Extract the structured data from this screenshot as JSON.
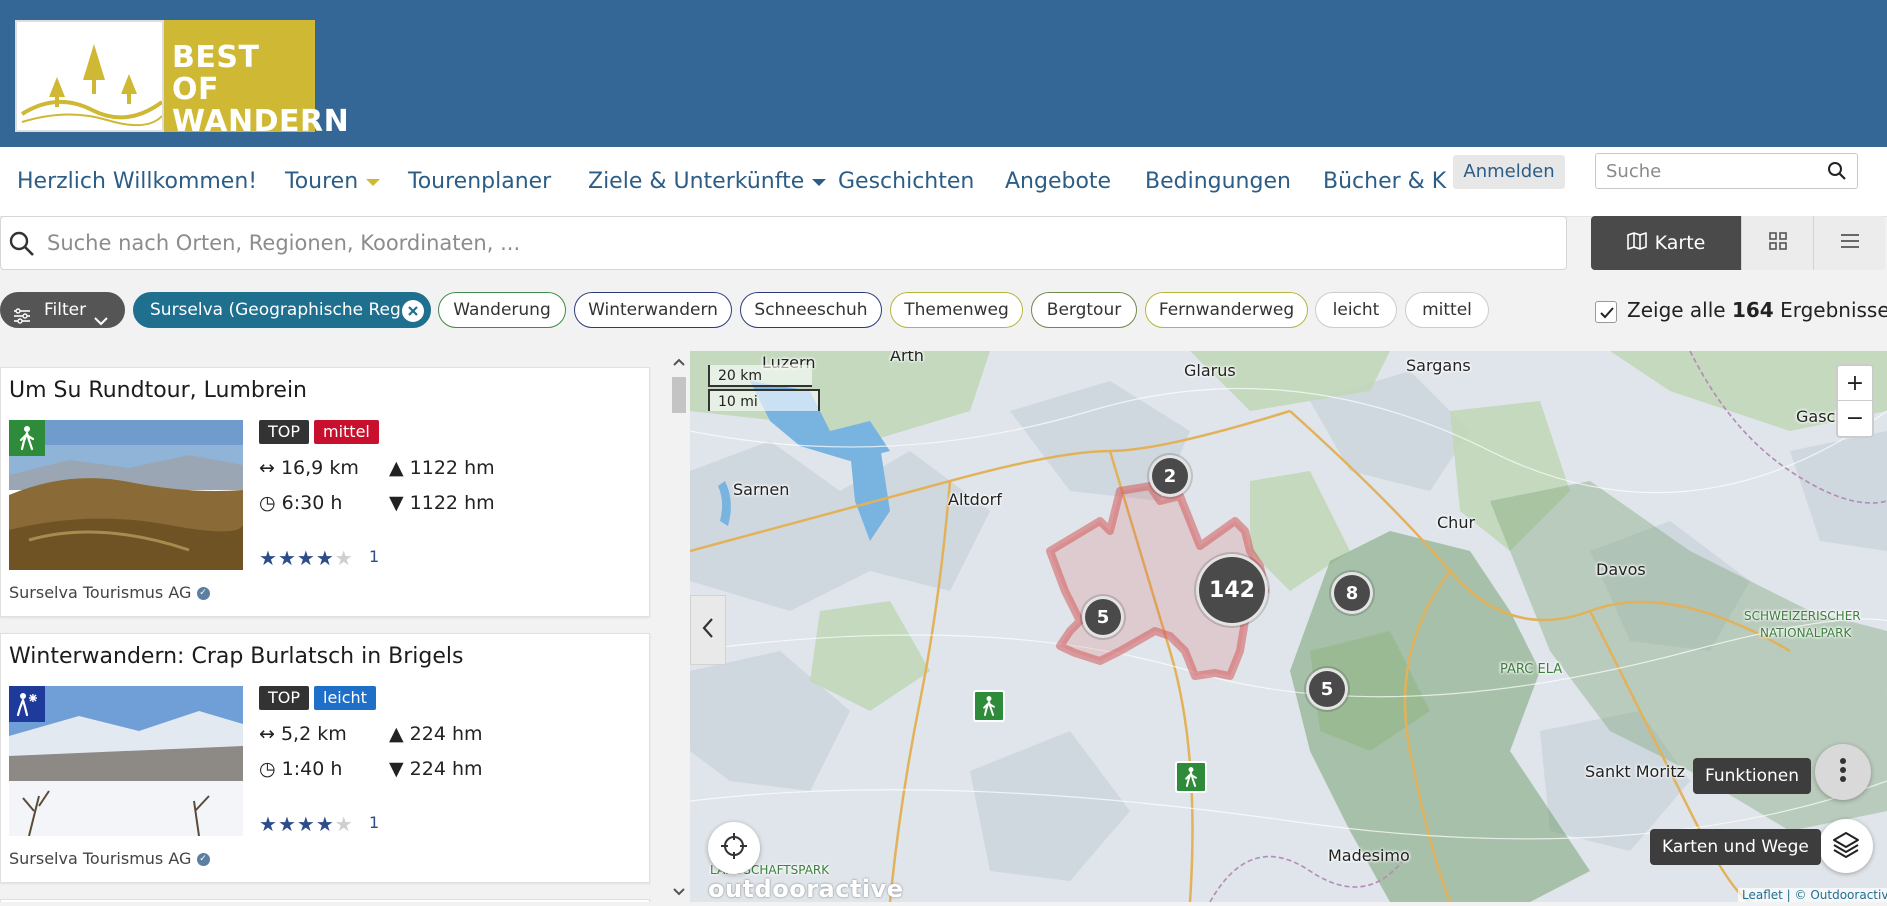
{
  "logo": {
    "line1": "BEST OF",
    "line2": "WANDERN"
  },
  "nav": {
    "items": [
      "Herzlich Willkommen!",
      "Touren",
      "Tourenplaner",
      "Ziele & Unterkünfte",
      "Geschichten",
      "Angebote",
      "Bedingungen",
      "Bücher & Ka"
    ],
    "login_label": "Anmelden",
    "search_placeholder": "Suche"
  },
  "search": {
    "placeholder": "Suche nach Orten, Regionen, Koordinaten, ..."
  },
  "view_toggle": {
    "map_label": "Karte"
  },
  "filters": {
    "filter_label": "Filter",
    "region": "Surselva (Geographische Reg...",
    "chips": [
      "Wanderung",
      "Winterwandern",
      "Schneeschuh",
      "Themenweg",
      "Bergtour",
      "Fernwanderweg",
      "leicht",
      "mittel"
    ]
  },
  "results": {
    "prefix": "Zeige alle",
    "count": "164",
    "suffix": "Ergebnisse"
  },
  "tours": [
    {
      "title": "Um Su Rundtour, Lumbrein",
      "tag_top": "TOP",
      "difficulty": "mittel",
      "distance": "16,9 km",
      "duration": "6:30 h",
      "ascent": "1122 hm",
      "descent": "1122 hm",
      "rating": 4,
      "rating_count": "1",
      "author": "Surselva Tourismus AG"
    },
    {
      "title": "Winterwandern: Crap Burlatsch in Brigels",
      "tag_top": "TOP",
      "difficulty": "leicht",
      "distance": "5,2 km",
      "duration": "1:40 h",
      "ascent": "224 hm",
      "descent": "224 hm",
      "rating": 4,
      "rating_count": "1",
      "author": "Surselva Tourismus AG"
    }
  ],
  "map": {
    "scale_km": "20 km",
    "scale_mi": "10 mi",
    "places": [
      "Luzern",
      "Arth",
      "Glarus",
      "Sargans",
      "Gaschurn",
      "Sarnen",
      "Altdorf",
      "Chur",
      "Davos",
      "SCHWEIZERISCHER",
      "NATIONALPARK",
      "PARC ELA",
      "Sankt Moritz",
      "Madesimo",
      "LANDSCHAFTSPARK"
    ],
    "clusters": [
      "2",
      "142",
      "5",
      "8",
      "5"
    ],
    "tooltip_functions": "Funktionen",
    "tooltip_layers": "Karten und Wege",
    "watermark": "outdooractive",
    "attribution": "Leaflet | © Outdooractive"
  }
}
